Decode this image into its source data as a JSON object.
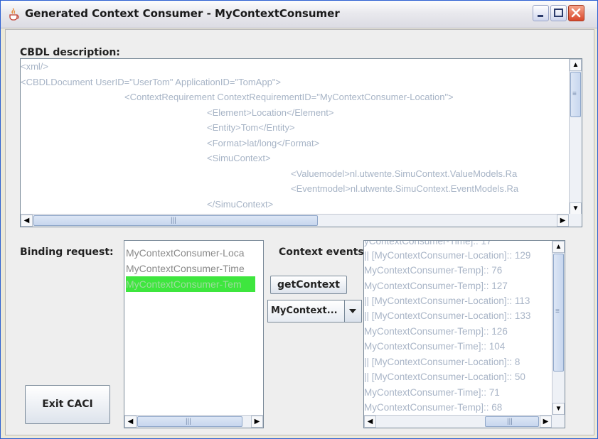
{
  "window": {
    "title": "Generated Context Consumer - MyContextConsumer",
    "accent": "#2b5fd1",
    "icon": "java-cup-icon"
  },
  "cbdl": {
    "label": "CBDL description:",
    "lines": [
      "<xml/>",
      "<CBDLDocument UserID=\"UserTom\" ApplicationID=\"TomApp\">",
      "<ContextRequirement ContextRequirementID=\"MyContextConsumer-Location\">",
      "<Element>Location</Element>",
      "<Entity>Tom</Entity>",
      "<Format>lat/long</Format>",
      "<SimuContext>",
      "<Valuemodel>nl.utwente.SimuContext.ValueModels.Ra",
      "<Eventmodel>nl.utwente.SimuContext.EventModels.Ra",
      "</SimuContext>"
    ]
  },
  "binding": {
    "label": "Binding request:",
    "items": [
      "MyContextConsumer-Loca",
      "MyContextConsumer-Time",
      "MyContextConsumer-Tem"
    ],
    "selected_index": 2,
    "selected_color": "#3ee63e"
  },
  "context_events": {
    "label": "Context events:",
    "lines": [
      "yContextConsumer-Time]:: 17",
      "|| [MyContextConsumer-Location]:: 129",
      "MyContextConsumer-Temp]:: 76",
      "MyContextConsumer-Temp]:: 127",
      "|| [MyContextConsumer-Location]:: 113",
      "|| [MyContextConsumer-Location]:: 133",
      "MyContextConsumer-Temp]:: 126",
      "MyContextConsumer-Time]:: 104",
      "|| [MyContextConsumer-Location]:: 8",
      "|| [MyContextConsumer-Location]:: 50",
      "MyContextConsumer-Time]:: 71",
      "MyContextConsumer-Temp]:: 68"
    ]
  },
  "buttons": {
    "get_context": "getContext",
    "exit": "Exit CACI"
  },
  "combo": {
    "selected": "MyContext..."
  }
}
